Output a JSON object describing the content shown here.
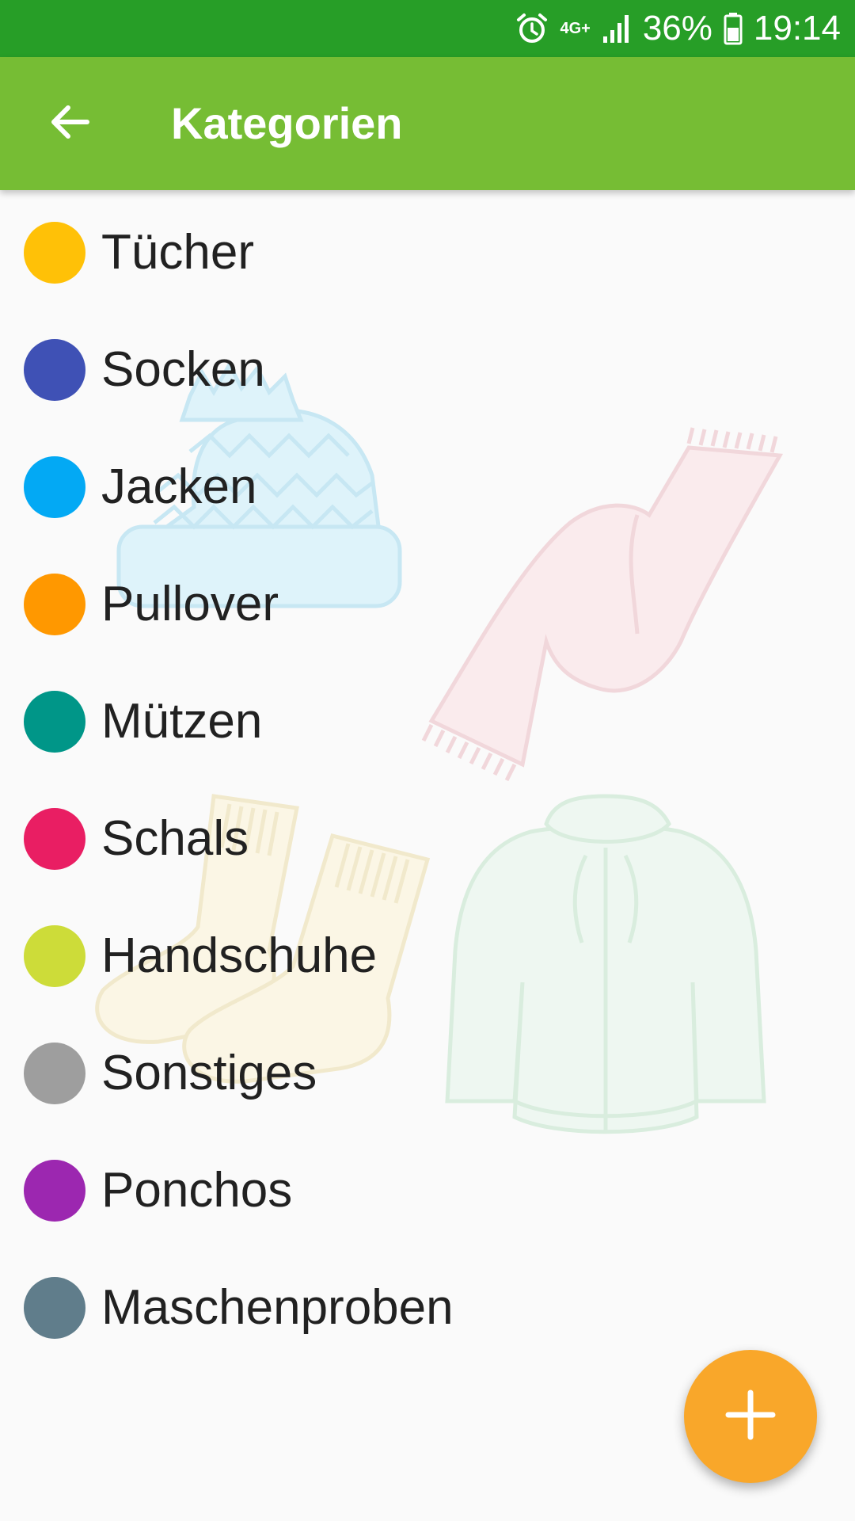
{
  "status_bar": {
    "network": "4G+",
    "battery": "36%",
    "time": "19:14",
    "icons": [
      "alarm-icon",
      "signal-icon",
      "battery-icon"
    ]
  },
  "app_bar": {
    "title": "Kategorien",
    "back_icon": "arrow-back-icon",
    "background": "#76bd34"
  },
  "categories": [
    {
      "label": "Tücher",
      "color": "#ffc107"
    },
    {
      "label": "Socken",
      "color": "#3f51b5"
    },
    {
      "label": "Jacken",
      "color": "#03a9f4"
    },
    {
      "label": "Pullover",
      "color": "#ff9800"
    },
    {
      "label": "Mützen",
      "color": "#009688"
    },
    {
      "label": "Schals",
      "color": "#e91e63"
    },
    {
      "label": "Handschuhe",
      "color": "#cddc39"
    },
    {
      "label": "Sonstiges",
      "color": "#9e9e9e"
    },
    {
      "label": "Ponchos",
      "color": "#9c27b0"
    },
    {
      "label": "Maschenproben",
      "color": "#607d8b"
    }
  ],
  "fab": {
    "icon": "plus-icon",
    "color": "#f9a72a"
  }
}
